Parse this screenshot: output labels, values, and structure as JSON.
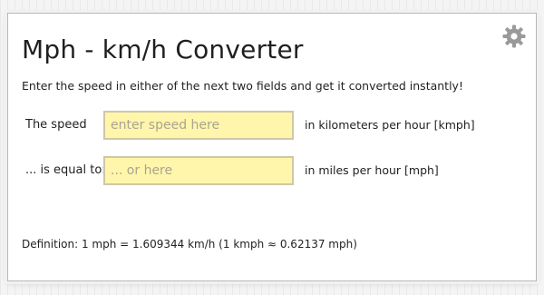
{
  "converter": {
    "title": "Mph - km/h Converter",
    "subtitle": "Enter the speed in either of the next two fields and get it converted instantly!",
    "settings_icon": "gear-icon",
    "speed_label": "The speed",
    "speed_placeholder": "enter speed here",
    "speed_value": "",
    "speed_unit": "in kilometers per hour [kmph]",
    "equal_label": "... is equal to:",
    "equal_placeholder": "... or here",
    "equal_value": "",
    "equal_unit": "in miles per hour [mph]",
    "definition": "Definition: 1 mph = 1.609344 km/h (1 kmph ≈ 0.62137 mph)"
  },
  "colors": {
    "field_bg": "#fff6ab",
    "field_border": "#cfc7a4",
    "gear": "#9a9a9a"
  }
}
